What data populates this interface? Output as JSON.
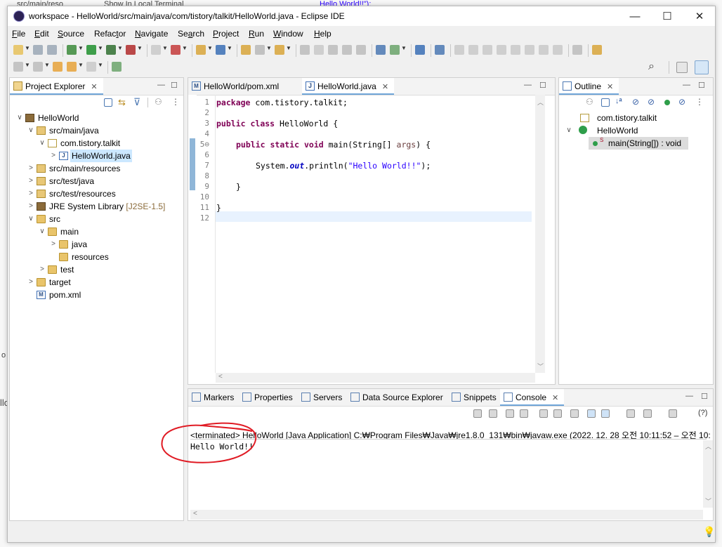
{
  "background": {
    "line1": "src/main/reso",
    "line2": "Show In Local Terminal",
    "line3": "Hello World!!\");",
    "left_fragment": "llo",
    "left_fragment2": "o"
  },
  "window": {
    "title": "workspace - HelloWorld/src/main/java/com/tistory/talkit/HelloWorld.java - Eclipse IDE",
    "minimize": "—",
    "maximize": "☐",
    "close": "✕"
  },
  "menu": [
    {
      "mnemonic": "F",
      "rest": "ile"
    },
    {
      "mnemonic": "E",
      "rest": "dit"
    },
    {
      "mnemonic": "S",
      "rest": "ource"
    },
    {
      "mnemonic": "",
      "pre": "Refac",
      "u": "t",
      "rest": "or"
    },
    {
      "mnemonic": "N",
      "rest": "avigate"
    },
    {
      "mnemonic": "",
      "pre": "Se",
      "u": "a",
      "rest": "rch"
    },
    {
      "mnemonic": "P",
      "rest": "roject"
    },
    {
      "mnemonic": "R",
      "rest": "un"
    },
    {
      "mnemonic": "W",
      "rest": "indow"
    },
    {
      "mnemonic": "H",
      "rest": "elp"
    }
  ],
  "project_explorer": {
    "tab_label": "Project Explorer",
    "items": [
      {
        "label": "HelloWorld",
        "depth": 0,
        "icon": "project-icon",
        "twisty": "∨"
      },
      {
        "label": "src/main/java",
        "depth": 1,
        "icon": "source-folder-icon",
        "twisty": "∨"
      },
      {
        "label": "com.tistory.talkit",
        "depth": 2,
        "icon": "package-icon",
        "twisty": "∨"
      },
      {
        "label": "HelloWorld.java",
        "depth": 3,
        "icon": "java-file-icon",
        "twisty": ">",
        "selected": true
      },
      {
        "label": "src/main/resources",
        "depth": 1,
        "icon": "source-folder-icon",
        "twisty": ">"
      },
      {
        "label": "src/test/java",
        "depth": 1,
        "icon": "source-folder-icon",
        "twisty": ">"
      },
      {
        "label": "src/test/resources",
        "depth": 1,
        "icon": "source-folder-icon",
        "twisty": ">"
      },
      {
        "label": "JRE System Library",
        "suffix": "[J2SE-1.5]",
        "depth": 1,
        "icon": "library-icon",
        "twisty": ">"
      },
      {
        "label": "src",
        "depth": 1,
        "icon": "folder-icon",
        "twisty": "∨"
      },
      {
        "label": "main",
        "depth": 2,
        "icon": "folder-icon",
        "twisty": "∨"
      },
      {
        "label": "java",
        "depth": 3,
        "icon": "folder-icon",
        "twisty": ">"
      },
      {
        "label": "resources",
        "depth": 3,
        "icon": "folder-icon",
        "twisty": ""
      },
      {
        "label": "test",
        "depth": 2,
        "icon": "folder-icon",
        "twisty": ">"
      },
      {
        "label": "target",
        "depth": 1,
        "icon": "folder-icon",
        "twisty": ">"
      },
      {
        "label": "pom.xml",
        "depth": 1,
        "icon": "maven-file-icon",
        "twisty": ""
      }
    ]
  },
  "editor": {
    "tabs": [
      {
        "label": "HelloWorld/pom.xml",
        "active": false
      },
      {
        "label": "HelloWorld.java",
        "active": true,
        "close": "✕"
      }
    ],
    "line_numbers": [
      "1",
      "2",
      "3",
      "4",
      "5⊖",
      "6",
      "7",
      "8",
      "9",
      "10",
      "11",
      "12"
    ],
    "code": {
      "l1_kw": "package",
      "l1_rest": " com.tistory.talkit;",
      "l3_kw1": "public",
      "l3_kw2": "class",
      "l3_rest": " HelloWorld {",
      "l5_kw1": "public",
      "l5_kw2": "static",
      "l5_kw3": "void",
      "l5_mid": " main(String[] ",
      "l5_param": "args",
      "l5_end": ") {",
      "l7_a": "System.",
      "l7_field": "out",
      "l7_b": ".println(",
      "l7_str": "\"Hello World!!\"",
      "l7_c": ");",
      "l9": "}",
      "l11": "}"
    }
  },
  "outline": {
    "tab_label": "Outline",
    "items": [
      {
        "label": "com.tistory.talkit"
      },
      {
        "label": "HelloWorld"
      },
      {
        "label": "main(String[]) : void"
      }
    ],
    "static_marker": "S"
  },
  "bottom": {
    "tabs": [
      {
        "label": "Markers"
      },
      {
        "label": "Properties"
      },
      {
        "label": "Servers"
      },
      {
        "label": "Data Source Explorer"
      },
      {
        "label": "Snippets"
      },
      {
        "label": "Console",
        "active": true,
        "close": "✕"
      }
    ],
    "console_header": "<terminated> HelloWorld [Java Application] C:₩Program Files₩Java₩jre1.8.0_131₩bin₩javaw.exe  (2022. 12. 28 오전 10:11:52 – 오전 10:",
    "console_output": "Hello World!!",
    "help_glyph": "(?)"
  },
  "colors": {
    "keyword": "#7f0055",
    "string": "#2a00ff",
    "field": "#0000c0",
    "selection": "#cce8ff",
    "annotation_circle": "#e01b24"
  }
}
